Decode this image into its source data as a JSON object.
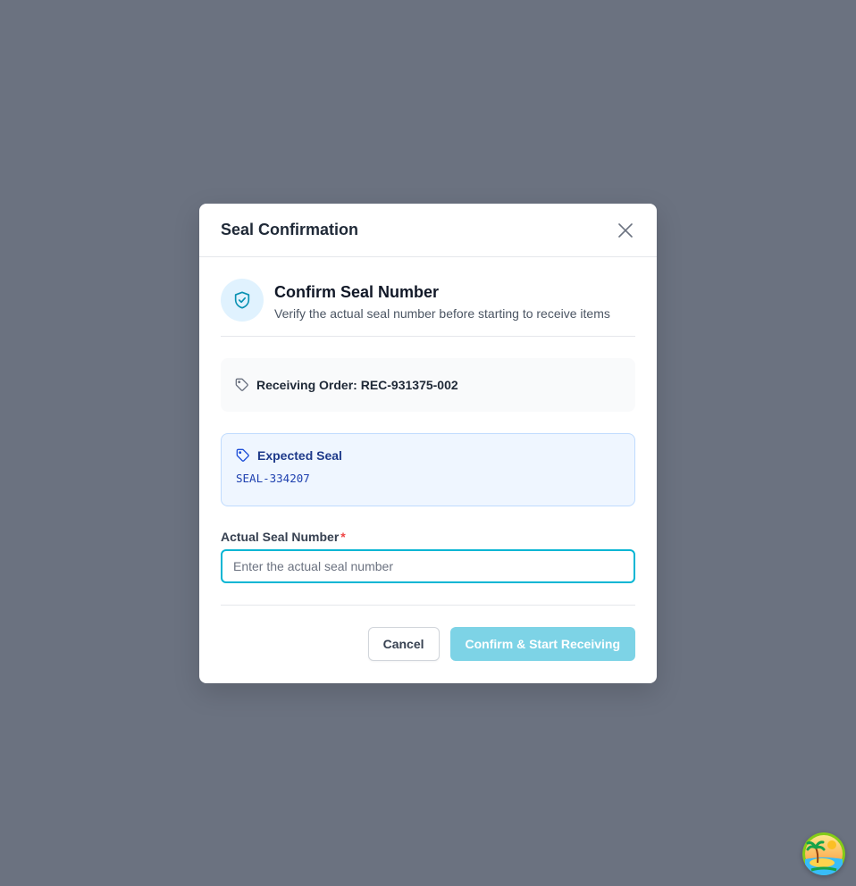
{
  "modal": {
    "title": "Seal Confirmation",
    "close_icon": "close-icon"
  },
  "intro": {
    "icon": "shield-check-icon",
    "title": "Confirm Seal Number",
    "subtitle": "Verify the actual seal number before starting to receive items"
  },
  "order": {
    "icon": "tag-icon",
    "text": "Receiving Order: REC-931375-002"
  },
  "expected": {
    "icon": "tag-icon",
    "label": "Expected Seal",
    "value": "SEAL-334207"
  },
  "field": {
    "label": "Actual Seal Number",
    "required_marker": "*",
    "placeholder": "Enter the actual seal number",
    "value": ""
  },
  "buttons": {
    "cancel": "Cancel",
    "confirm": "Confirm & Start Receiving"
  },
  "colors": {
    "accent": "#06b6d4",
    "overlay": "#6b7280",
    "confirm_disabled": "#7dd3e6"
  },
  "corner": {
    "icon": "tropical-island-avatar-icon"
  }
}
